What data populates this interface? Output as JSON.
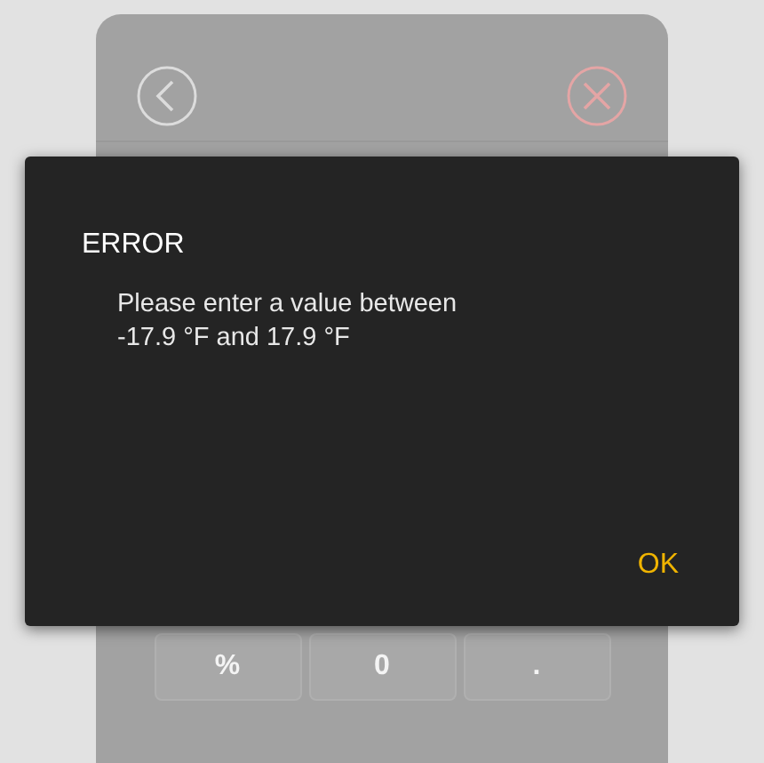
{
  "keypad": {
    "keys": [
      "%",
      "0",
      "."
    ]
  },
  "dialog": {
    "title": "ERROR",
    "message": "Please enter a value between\n-17.9 °F and 17.9 °F",
    "buttons": [
      "OK"
    ]
  }
}
